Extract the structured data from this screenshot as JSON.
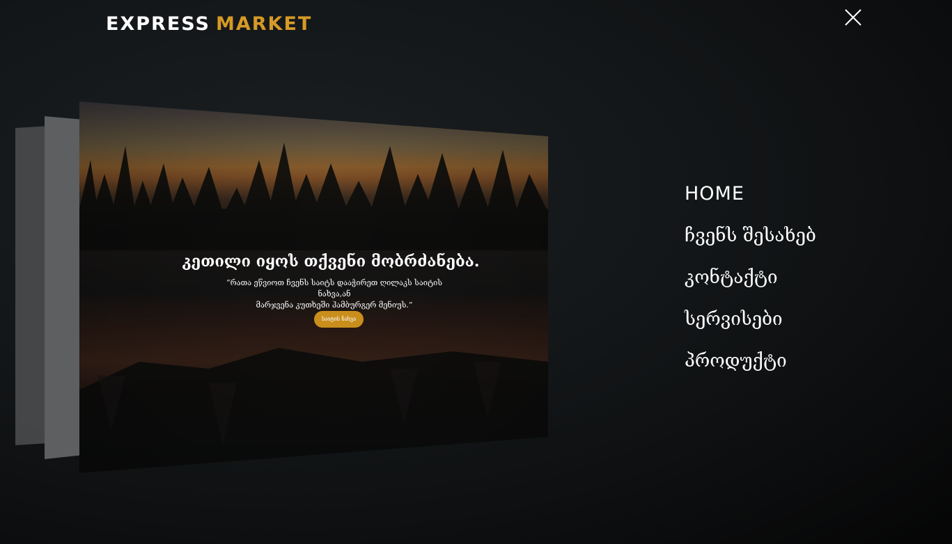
{
  "header": {
    "logo_part1": "EXPRESS",
    "logo_part2": "MARKET",
    "close_icon": "close-icon"
  },
  "hero": {
    "title": "კეთილი იყოს თქვენი მობრძანება.",
    "subtitle_line1": "“რათა ეწვიოთ ჩვენს საიტს დააჭირეთ ღილაკს საიტის ნახვა,ან",
    "subtitle_line2": "მარჯვენა კუთხეში ჰამბურგერ მენიუს.”",
    "button_label": "საიტის ნახვა"
  },
  "menu": {
    "items": [
      {
        "label": "HOME"
      },
      {
        "label": "ჩვენს შესახებ"
      },
      {
        "label": "კონტაქტი"
      },
      {
        "label": "სერვისები"
      },
      {
        "label": "პროდუქტი"
      }
    ]
  },
  "colors": {
    "background": "#111315",
    "accent": "#d69a26",
    "button": "#c98e1c",
    "text": "#ffffff"
  }
}
